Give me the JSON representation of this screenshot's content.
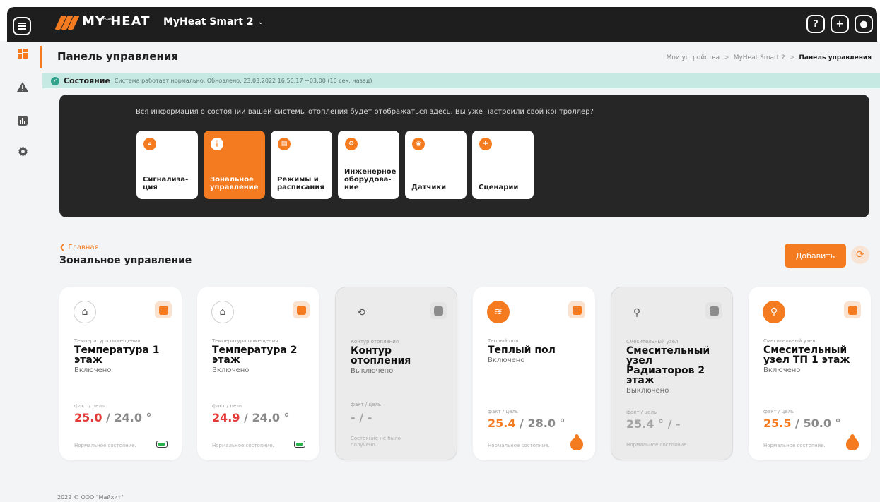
{
  "header": {
    "logo_text": "MY HEAT",
    "logo_sub": "by EVAN",
    "device": "MyHeat Smart 2",
    "icons": [
      "help-icon",
      "add-user-icon",
      "profile-icon"
    ]
  },
  "sidebar": {
    "items": [
      "dashboard-icon",
      "alert-icon",
      "stats-icon",
      "settings-icon"
    ]
  },
  "page": {
    "title": "Панель управления",
    "breadcrumb": [
      "Мои устройства",
      "MyHeat Smart 2",
      "Панель управления"
    ]
  },
  "status": {
    "title": "Состояние",
    "text": "Система работает нормально. Обновлено: 23.03.2022 16:50:17 +03:00 (10 сек. назад)"
  },
  "info_panel": {
    "text": "Вся информация о состоянии вашей системы отопления будет отображаться здесь. Вы уже настроили свой контроллер?",
    "tiles": [
      {
        "label": "Сигнализа-\nция"
      },
      {
        "label": "Зональное\nуправление"
      },
      {
        "label": "Режимы и\nрасписания"
      },
      {
        "label": "Инженерное\nоборудова-\nние"
      },
      {
        "label": "Датчики"
      },
      {
        "label": "Сценарии"
      }
    ]
  },
  "section": {
    "back": "Главная",
    "title": "Зональное управление",
    "add_label": "Добавить"
  },
  "cards": [
    {
      "type": "Температура помещения",
      "name": "Температура 1 этаж",
      "state": "Включено",
      "fact_label": "факт / цель",
      "fact": "25.0",
      "target": " / 24.0 °",
      "norm": "Нормальное состояние."
    },
    {
      "type": "Температура помещения",
      "name": "Температура 2 этаж",
      "state": "Включено",
      "fact_label": "факт / цель",
      "fact": "24.9",
      "target": " / 24.0 °",
      "norm": "Нормальное состояние."
    },
    {
      "type": "Контур отопления",
      "name": "Контур отопления",
      "state": "Выключено",
      "fact_label": "факт / цель",
      "fact": "",
      "target": "- / -",
      "norm": "Состояние не было получено."
    },
    {
      "type": "Теплый пол",
      "name": "Теплый пол",
      "state": "Включено",
      "fact_label": "факт / цель",
      "fact": "25.4",
      "target": " / 28.0 °",
      "norm": "Нормальное состояние."
    },
    {
      "type": "Смесительный узел",
      "name": "Смесительный узел Радиаторов 2 этаж",
      "state": "Выключено",
      "fact_label": "факт / цель",
      "fact": "",
      "target": "25.4 ° / -",
      "norm": "Нормальное состояние."
    },
    {
      "type": "Смесительный узел",
      "name": "Смесительный узел ТП 1 этаж",
      "state": "Включено",
      "fact_label": "факт / цель",
      "fact": "25.5",
      "target": " / 50.0 °",
      "norm": "Нормальное состояние."
    }
  ],
  "footer": "2022 © ООО \"Майхит\"",
  "colors": {
    "accent": "#f47b20",
    "status_bg": "#c7e9e3",
    "alert_red": "#e33a3a"
  }
}
